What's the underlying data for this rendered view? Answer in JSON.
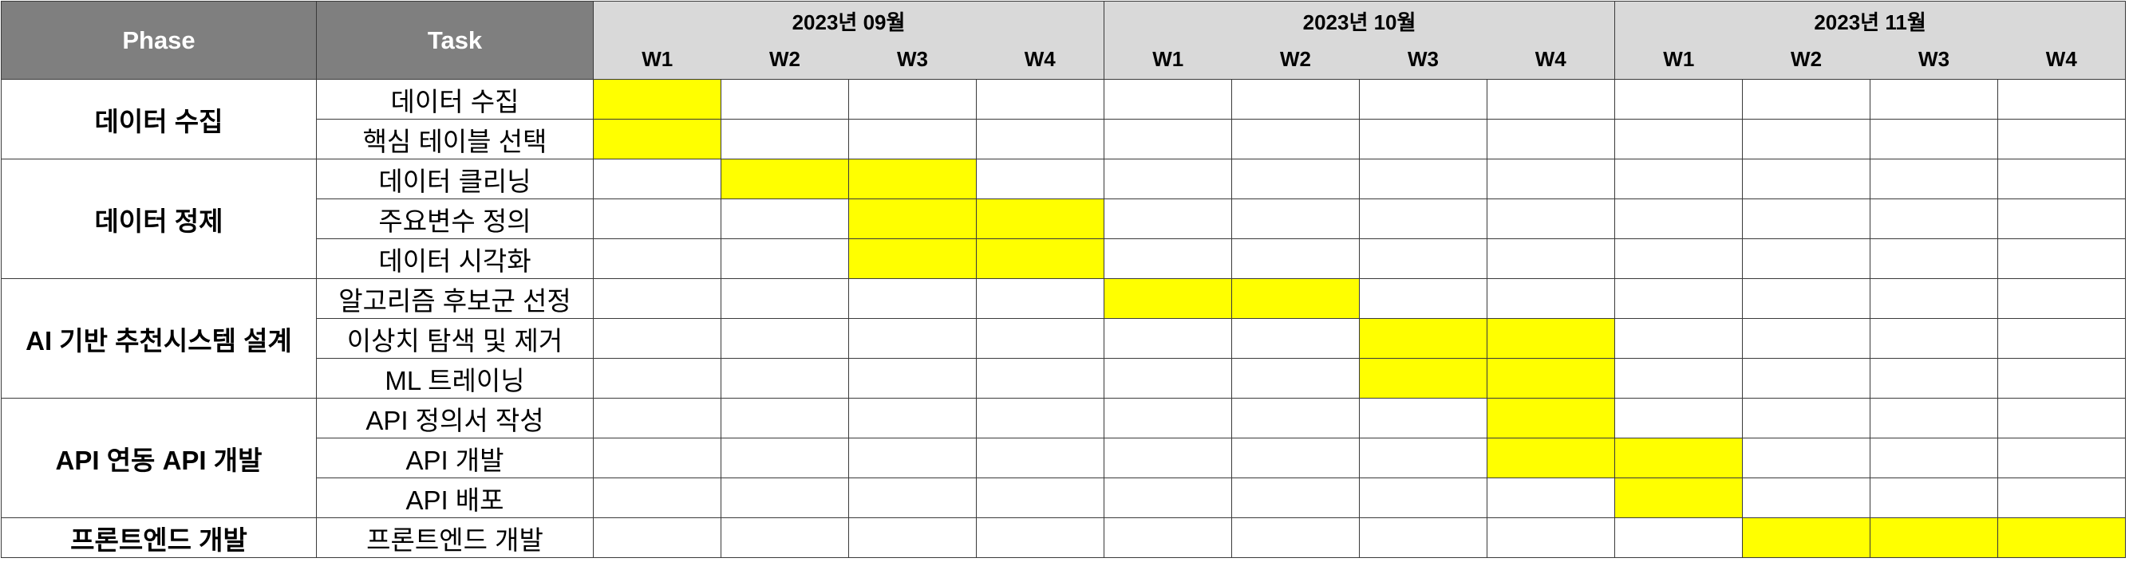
{
  "header": {
    "phase_label": "Phase",
    "task_label": "Task",
    "months": [
      "2023년 09월",
      "2023년 10월",
      "2023년 11월"
    ],
    "weeks": [
      "W1",
      "W2",
      "W3",
      "W4",
      "W1",
      "W2",
      "W3",
      "W4",
      "W1",
      "W2",
      "W3",
      "W4"
    ]
  },
  "colors": {
    "header_bg": "#7f7f7f",
    "subheader_bg": "#d9d9d9",
    "active_bar": "#ffff00"
  },
  "phases": [
    {
      "name": "데이터 수집",
      "tasks": [
        {
          "name": "데이터 수집",
          "weeks": [
            1
          ]
        },
        {
          "name": "핵심 테이블 선택",
          "weeks": [
            1
          ]
        }
      ]
    },
    {
      "name": "데이터 정제",
      "tasks": [
        {
          "name": "데이터 클리닝",
          "weeks": [
            2,
            3
          ]
        },
        {
          "name": "주요변수 정의",
          "weeks": [
            3,
            4
          ]
        },
        {
          "name": "데이터 시각화",
          "weeks": [
            3,
            4
          ]
        }
      ]
    },
    {
      "name": "AI 기반 추천시스템 설계",
      "tasks": [
        {
          "name": "알고리즘 후보군 선정",
          "weeks": [
            5,
            6
          ]
        },
        {
          "name": "이상치 탐색 및 제거",
          "weeks": [
            7,
            8
          ]
        },
        {
          "name": "ML 트레이닝",
          "weeks": [
            7,
            8
          ]
        }
      ]
    },
    {
      "name": "API 연동 API 개발",
      "tasks": [
        {
          "name": "API 정의서 작성",
          "weeks": [
            8
          ]
        },
        {
          "name": "API 개발",
          "weeks": [
            8,
            9
          ]
        },
        {
          "name": "API 배포",
          "weeks": [
            9
          ]
        }
      ]
    },
    {
      "name": "프론트엔드 개발",
      "tasks": [
        {
          "name": "프론트엔드 개발",
          "weeks": [
            10,
            11,
            12
          ]
        }
      ]
    }
  ]
}
